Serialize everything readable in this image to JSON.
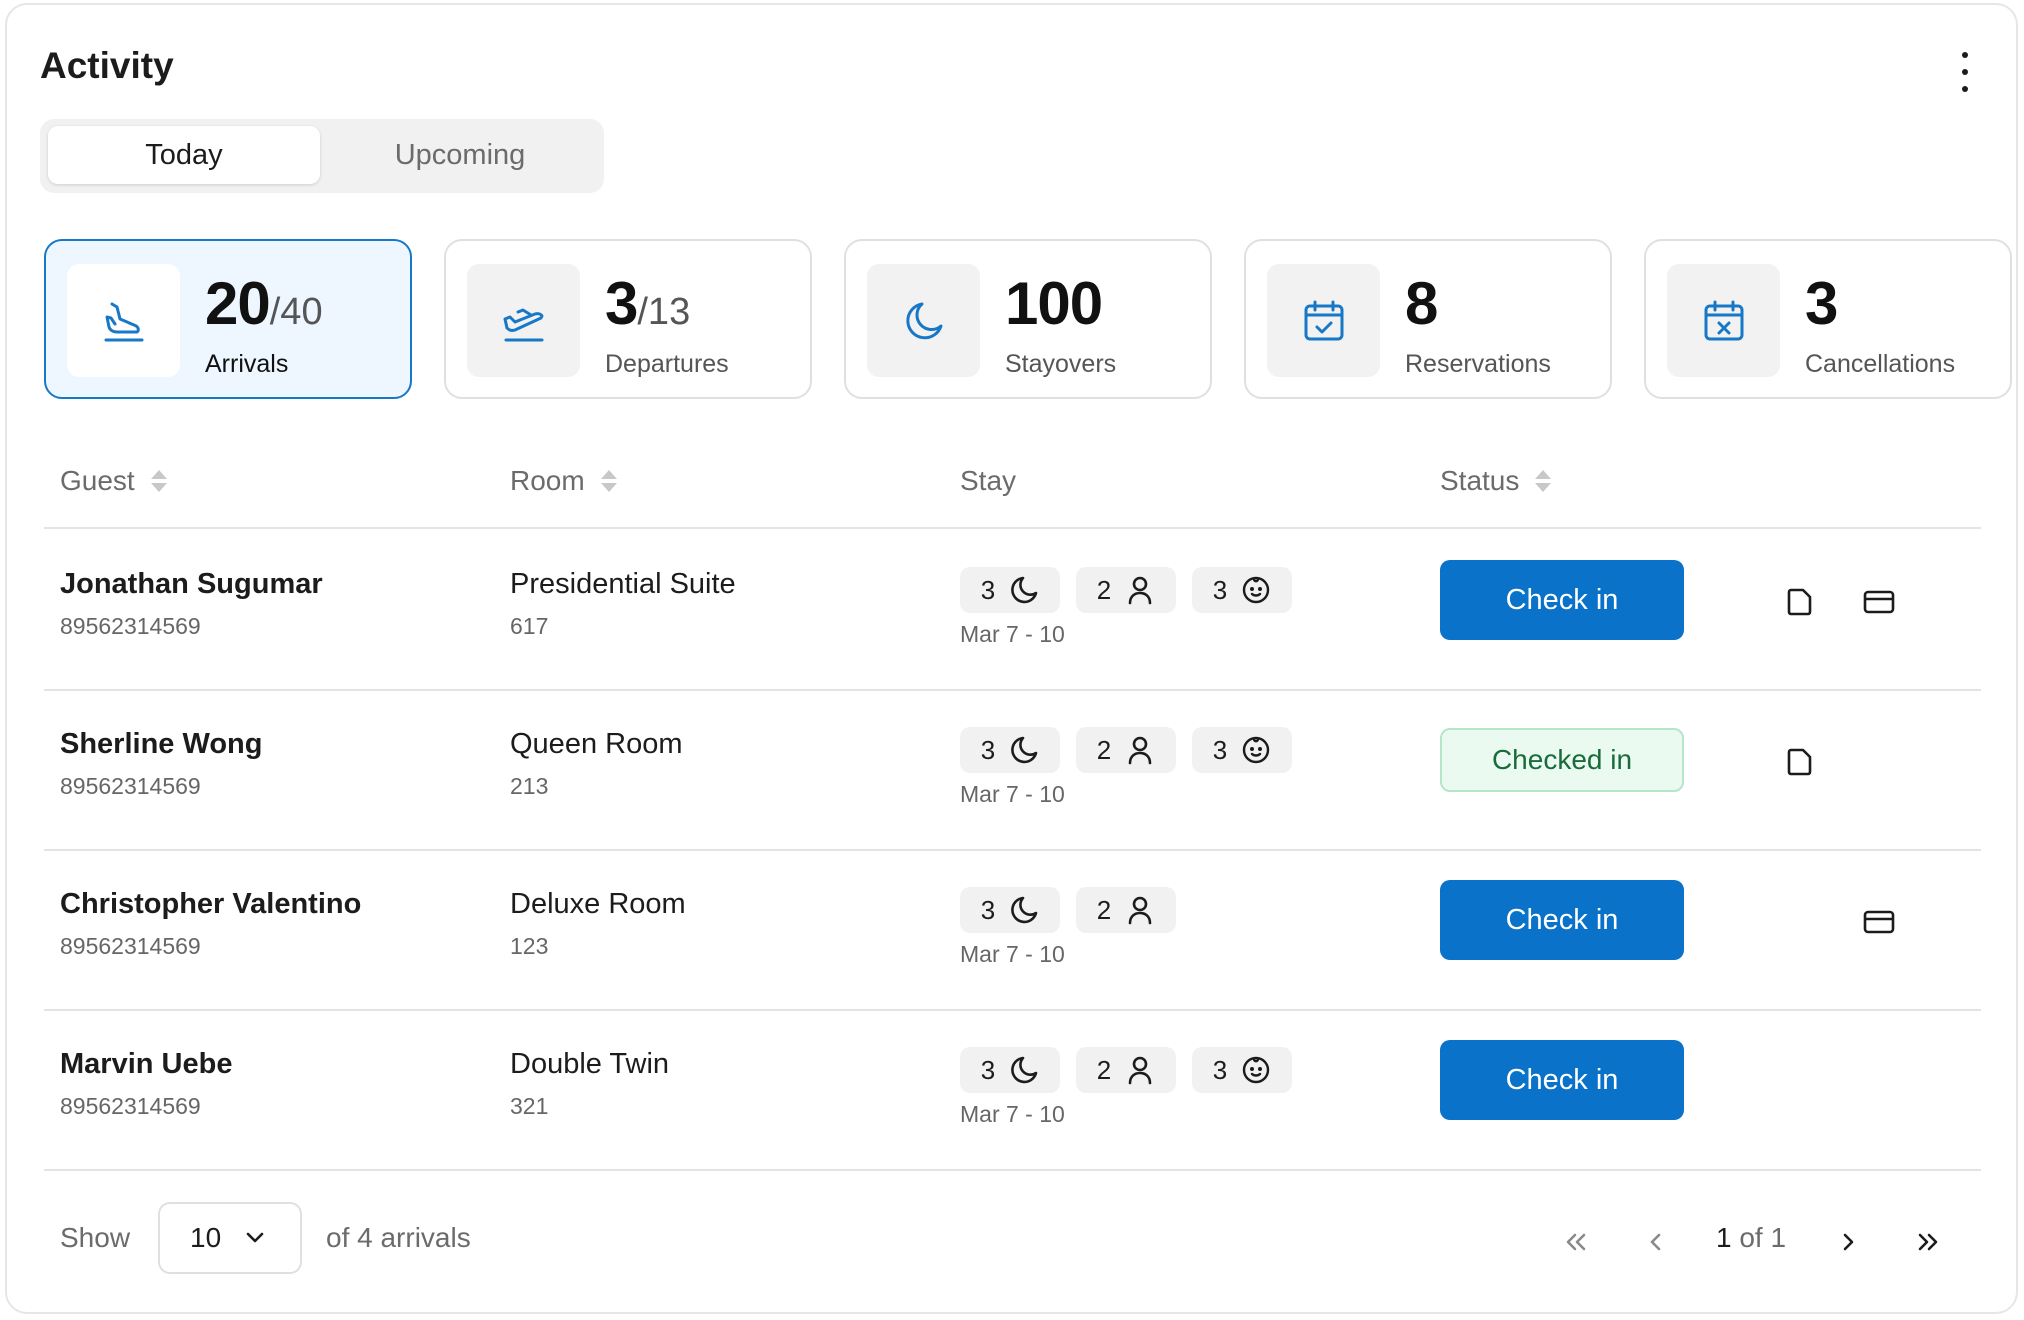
{
  "header": {
    "title": "Activity"
  },
  "tabs": [
    {
      "label": "Today"
    },
    {
      "label": "Upcoming"
    }
  ],
  "stats": [
    {
      "value": "20",
      "total": "/40",
      "label": "Arrivals",
      "icon": "plane-landing-icon"
    },
    {
      "value": "3",
      "total": "/13",
      "label": "Departures",
      "icon": "plane-takeoff-icon"
    },
    {
      "value": "100",
      "total": "",
      "label": "Stayovers",
      "icon": "moon-icon"
    },
    {
      "value": "8",
      "total": "",
      "label": "Reservations",
      "icon": "calendar-check-icon"
    },
    {
      "value": "3",
      "total": "",
      "label": "Cancellations",
      "icon": "calendar-x-icon"
    }
  ],
  "table": {
    "headers": {
      "guest": "Guest",
      "room": "Room",
      "stay": "Stay",
      "status": "Status"
    },
    "rows": [
      {
        "guest": "Jonathan Sugumar",
        "guest_id": "89562314569",
        "room": "Presidential Suite",
        "room_no": "617",
        "nights": "3",
        "adults": "2",
        "kids": "3",
        "dates": "Mar 7 - 10",
        "status": "Check in"
      },
      {
        "guest": "Sherline Wong",
        "guest_id": "89562314569",
        "room": "Queen Room",
        "room_no": "213",
        "nights": "3",
        "adults": "2",
        "kids": "3",
        "dates": "Mar 7 - 10",
        "status": "Checked in"
      },
      {
        "guest": "Christopher Valentino",
        "guest_id": "89562314569",
        "room": "Deluxe Room",
        "room_no": "123",
        "nights": "3",
        "adults": "2",
        "dates": "Mar 7 - 10",
        "status": "Check in"
      },
      {
        "guest": "Marvin Uebe",
        "guest_id": "89562314569",
        "room": "Double Twin",
        "room_no": "321",
        "nights": "3",
        "adults": "2",
        "kids": "3",
        "dates": "Mar 7 - 10",
        "status": "Check in"
      }
    ]
  },
  "footer": {
    "show_label": "Show",
    "page_size": "10",
    "count_text": "of 4 arrivals",
    "page_current": "1",
    "page_rest": " of 1"
  },
  "colors": {
    "accent": "#0a72c8",
    "active_card_bg": "#eef6ff",
    "checked_bg": "#eafaf1",
    "checked_text": "#1a6b3a"
  }
}
